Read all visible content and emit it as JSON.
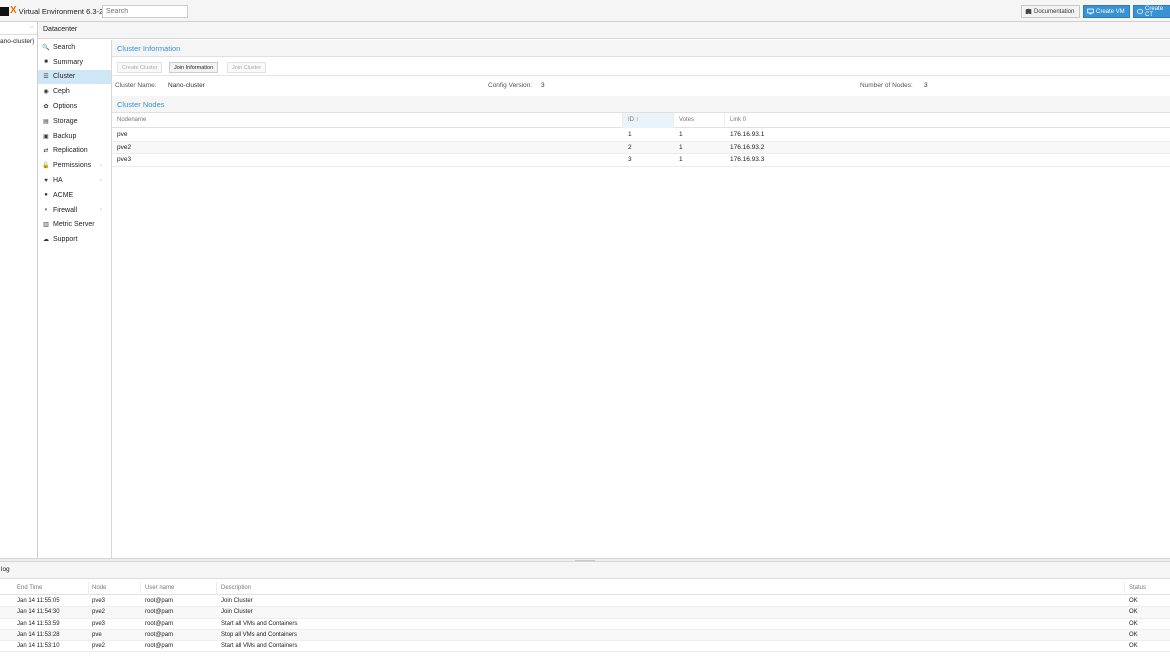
{
  "app": {
    "title": "Virtual Environment 6.3-2",
    "search_placeholder": "Search",
    "documentation_label": "Documentation",
    "create_vm_label": "Create VM",
    "create_ct_label": "Create CT"
  },
  "tree": {
    "node_label": "ano-cluster)"
  },
  "datacenter": {
    "title": "Datacenter"
  },
  "nav": {
    "items": [
      {
        "label": "Search",
        "icon": "search-icon",
        "glyph": "🔍",
        "active": false,
        "arrow": false
      },
      {
        "label": "Summary",
        "icon": "book-icon",
        "glyph": "■",
        "active": false,
        "arrow": false
      },
      {
        "label": "Cluster",
        "icon": "server-icon",
        "glyph": "☰",
        "active": true,
        "arrow": false
      },
      {
        "label": "Ceph",
        "icon": "ceph-icon",
        "glyph": "◉",
        "active": false,
        "arrow": false
      },
      {
        "label": "Options",
        "icon": "gear-icon",
        "glyph": "✿",
        "active": false,
        "arrow": false
      },
      {
        "label": "Storage",
        "icon": "database-icon",
        "glyph": "▤",
        "active": false,
        "arrow": false
      },
      {
        "label": "Backup",
        "icon": "floppy-icon",
        "glyph": "▣",
        "active": false,
        "arrow": false
      },
      {
        "label": "Replication",
        "icon": "retweet-icon",
        "glyph": "⇄",
        "active": false,
        "arrow": false
      },
      {
        "label": "Permissions",
        "icon": "unlock-icon",
        "glyph": "🔓",
        "active": false,
        "arrow": true
      },
      {
        "label": "HA",
        "icon": "heartbeat-icon",
        "glyph": "♥",
        "active": false,
        "arrow": true
      },
      {
        "label": "ACME",
        "icon": "certificate-icon",
        "glyph": "●",
        "active": false,
        "arrow": false
      },
      {
        "label": "Firewall",
        "icon": "shield-icon",
        "glyph": "◗",
        "active": false,
        "arrow": true
      },
      {
        "label": "Metric Server",
        "icon": "bar-chart-icon",
        "glyph": "▥",
        "active": false,
        "arrow": false
      },
      {
        "label": "Support",
        "icon": "comments-icon",
        "glyph": "☁",
        "active": false,
        "arrow": false
      }
    ]
  },
  "cluster_info": {
    "title": "Cluster Information",
    "create_cluster_label": "Create Cluster",
    "join_information_label": "Join Information",
    "join_cluster_label": "Join Cluster",
    "cluster_name_label": "Cluster Name:",
    "cluster_name_value": "Nano-cluster",
    "config_version_label": "Config Version:",
    "config_version_value": "3",
    "number_of_nodes_label": "Number of Nodes:",
    "number_of_nodes_value": "3"
  },
  "cluster_nodes": {
    "title": "Cluster Nodes",
    "headers": {
      "nodename": "Nodename",
      "id": "ID ↑",
      "votes": "Votes",
      "link0": "Link 0"
    },
    "rows": [
      {
        "nodename": "pve",
        "id": "1",
        "votes": "1",
        "link0": "176.16.93.1"
      },
      {
        "nodename": "pve2",
        "id": "2",
        "votes": "1",
        "link0": "176.16.93.2"
      },
      {
        "nodename": "pve3",
        "id": "3",
        "votes": "1",
        "link0": "176.16.93.3"
      }
    ]
  },
  "task_log": {
    "title": "log",
    "headers": {
      "end_time": "End Time",
      "node": "Node",
      "user": "User name",
      "description": "Description",
      "status": "Status"
    },
    "rows": [
      {
        "end_time": "Jan 14 11:55:05",
        "node": "pve3",
        "user": "root@pam",
        "description": "Join Cluster",
        "status": "OK"
      },
      {
        "end_time": "Jan 14 11:54:30",
        "node": "pve2",
        "user": "root@pam",
        "description": "Join Cluster",
        "status": "OK"
      },
      {
        "end_time": "Jan 14 11:53:59",
        "node": "pve3",
        "user": "root@pam",
        "description": "Start all VMs and Containers",
        "status": "OK"
      },
      {
        "end_time": "Jan 14 11:53:28",
        "node": "pve",
        "user": "root@pam",
        "description": "Stop all VMs and Containers",
        "status": "OK"
      },
      {
        "end_time": "Jan 14 11:53:10",
        "node": "pve2",
        "user": "root@pam",
        "description": "Start all VMs and Containers",
        "status": "OK"
      }
    ]
  },
  "colors": {
    "accent": "#3892d4",
    "logo_orange": "#e57000",
    "active_nav": "#cfe6f7"
  }
}
